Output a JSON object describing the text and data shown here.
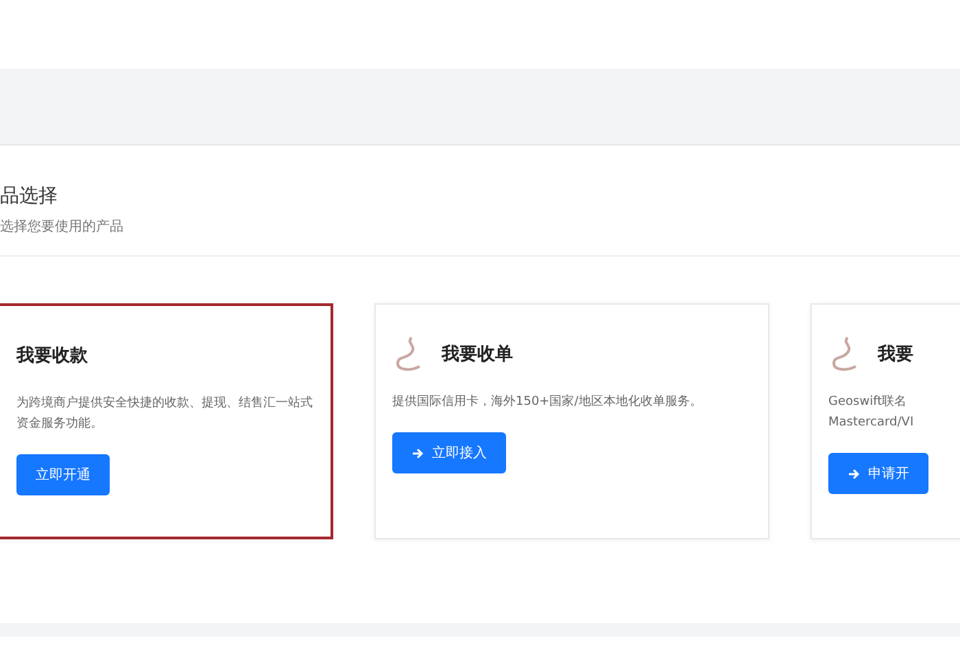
{
  "section": {
    "title": "品选择",
    "subtitle": "选择您要使用的产品"
  },
  "cards": [
    {
      "title": "我要收款",
      "icon": false,
      "description": "为跨境商户提供安全快捷的收款、提现、结售汇一站式资金服务功能。",
      "button": "立即开通",
      "arrow": false,
      "selected": true
    },
    {
      "title": "我要收单",
      "icon": true,
      "description": "提供国际信用卡，海外150+国家/地区本地化收单服务。",
      "button": "立即接入",
      "arrow": true,
      "selected": false
    },
    {
      "title": "我要",
      "icon": true,
      "description": "Geoswift联名 Mastercard/VI",
      "button": "申请开",
      "arrow": true,
      "selected": false
    }
  ]
}
